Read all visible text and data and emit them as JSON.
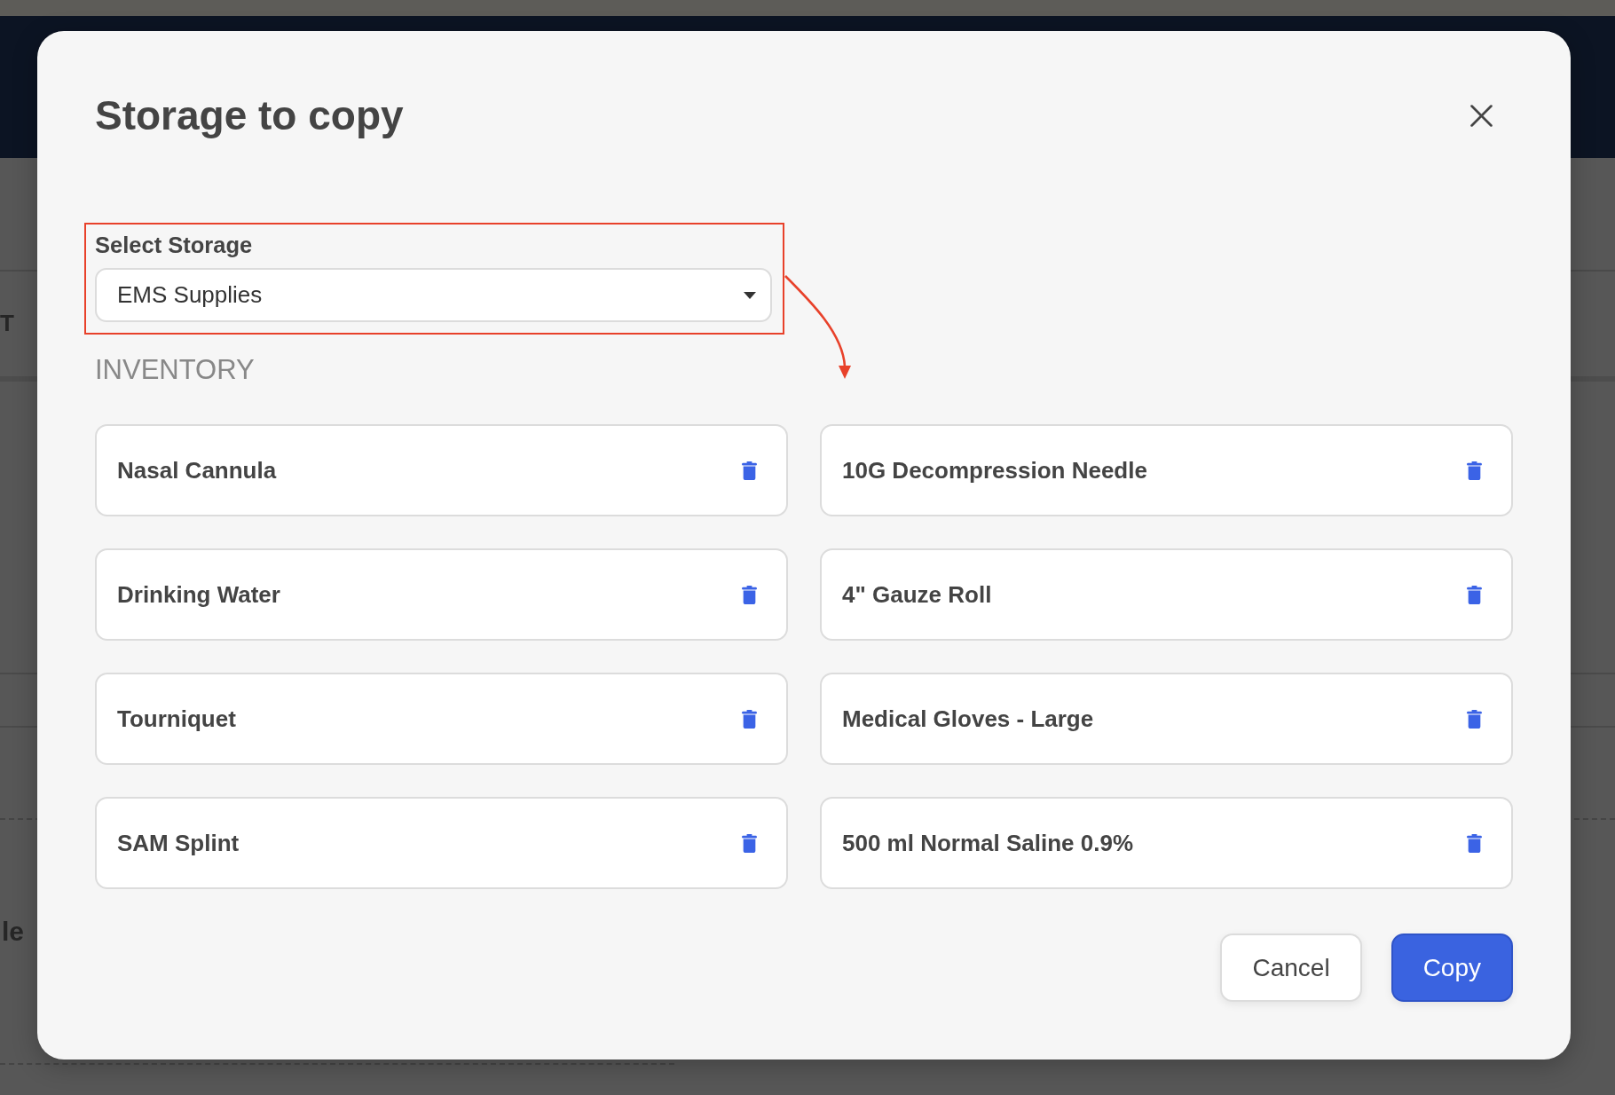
{
  "background_page": {
    "header_text": "T",
    "body_text": "le"
  },
  "dialog": {
    "title": "Storage to copy",
    "select_storage": {
      "label": "Select Storage",
      "value": "EMS Supplies",
      "highlighted": true
    },
    "section_title": "INVENTORY",
    "inventory_items": [
      "Nasal Cannula",
      "10G Decompression Needle",
      "Drinking Water",
      "4\" Gauze Roll",
      "Tourniquet",
      "Medical Gloves - Large",
      "SAM Splint",
      "500 ml Normal Saline 0.9%"
    ],
    "buttons": [
      {
        "label": "Cancel",
        "kind": "secondary"
      },
      {
        "label": "Copy",
        "kind": "primary"
      }
    ]
  }
}
